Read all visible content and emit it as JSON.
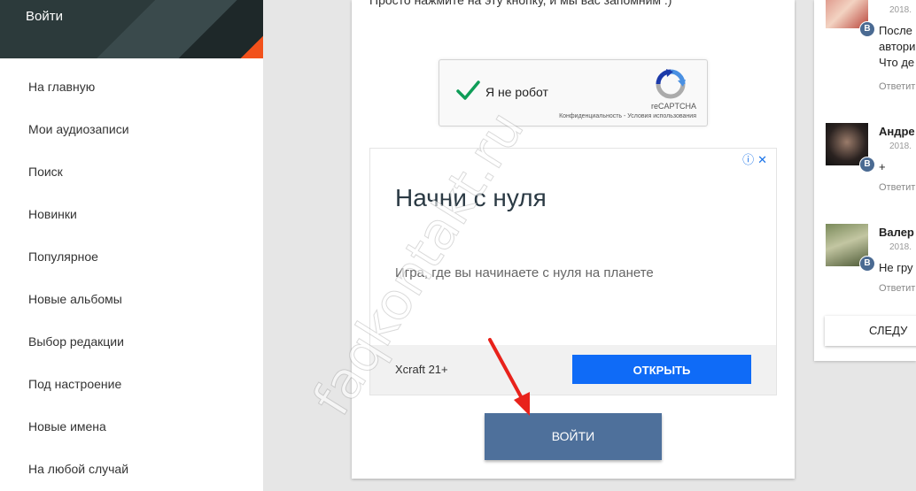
{
  "sidebar": {
    "login": "Войти",
    "items": [
      {
        "label": "На главную"
      },
      {
        "label": "Мои аудиозаписи"
      },
      {
        "label": "Поиск"
      },
      {
        "label": "Новинки"
      },
      {
        "label": "Популярное"
      },
      {
        "label": "Новые альбомы"
      },
      {
        "label": "Выбор редакции"
      },
      {
        "label": "Под настроение"
      },
      {
        "label": "Новые имена"
      },
      {
        "label": "На любой случай"
      }
    ]
  },
  "main": {
    "top_text": "Просто нажмите на эту кнопку, и мы вас запомним :)",
    "recaptcha": {
      "label": "Я не робот",
      "brand": "reCAPTCHA",
      "links": "Конфиденциальность - Условия использования",
      "check_color": "#0f9d58"
    },
    "ad": {
      "title": "Начни с нуля",
      "description": "Игра, где вы начинаете с нуля на планете",
      "brand": "Xcraft 21+",
      "button": "ОТКРЫТЬ",
      "icons": "ⓘ✕"
    },
    "login_button": "ВОЙТИ",
    "watermark": "faqkontakt.ru"
  },
  "comments": [
    {
      "name": "",
      "date": "2018.",
      "text": [
        "После",
        "автори",
        "Что де"
      ],
      "reply": "Ответит"
    },
    {
      "name": "Андре",
      "date": "2018.",
      "text": [
        "+"
      ],
      "reply": "Ответит"
    },
    {
      "name": "Валер",
      "date": "2018.",
      "text": [
        "Не гру"
      ],
      "reply": "Ответит"
    }
  ],
  "next_button": "СЛЕДУ",
  "colors": {
    "sidebar_header": "#2c3a3b",
    "accent_orange": "#f2511b",
    "login_button": "#4e709b",
    "ad_button": "#0f6bf7",
    "vk_badge": "#4a6a92"
  }
}
